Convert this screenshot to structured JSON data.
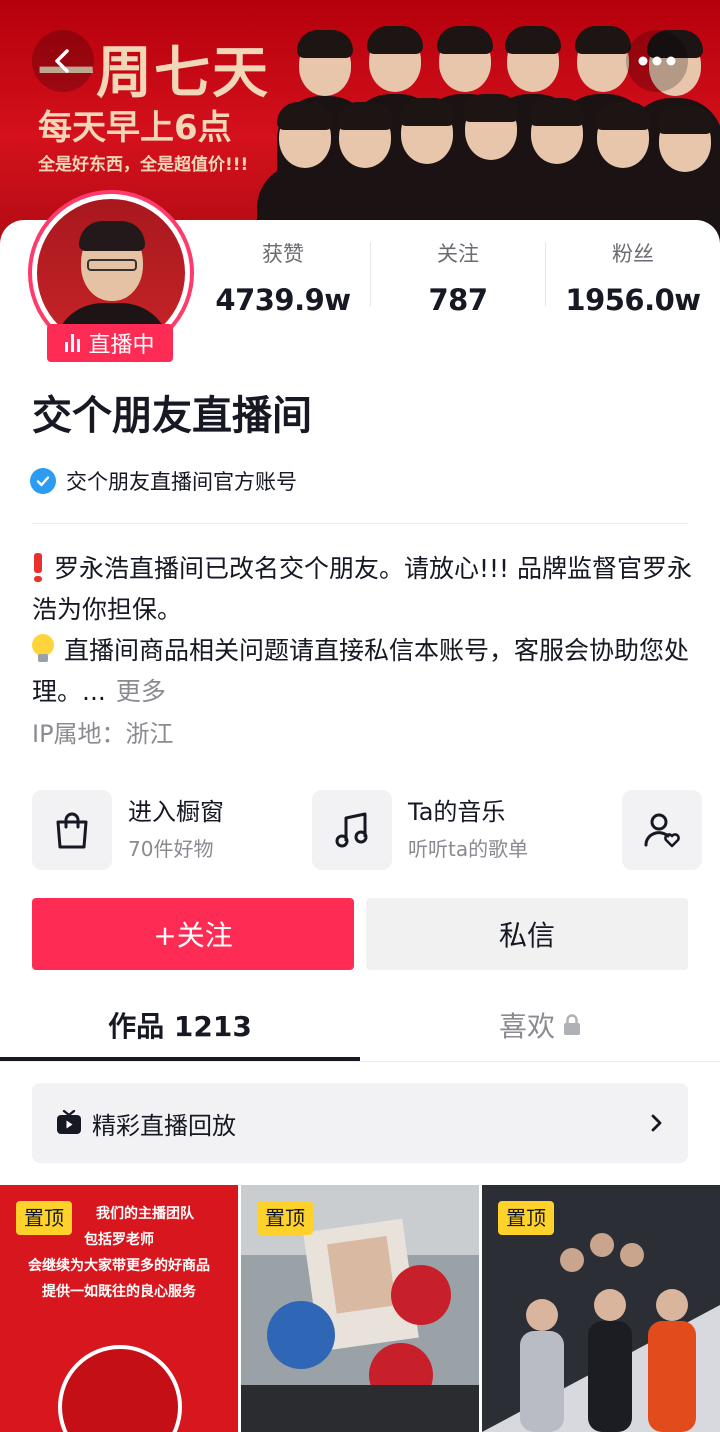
{
  "banner": {
    "line1": "一周七天",
    "line2": "每天早上6点",
    "line3": "全是好东西，全是超值价!!!"
  },
  "header": {
    "back_icon": "chevron-left-icon",
    "more_icon": "more-dots-icon"
  },
  "profile": {
    "live_label": "直播中",
    "name": "交个朋友直播间",
    "verified_text": "交个朋友直播间官方账号"
  },
  "stats": [
    {
      "label": "获赞",
      "value": "4739.9w"
    },
    {
      "label": "关注",
      "value": "787"
    },
    {
      "label": "粉丝",
      "value": "1956.0w"
    }
  ],
  "bio": {
    "line1": "罗永浩直播间已改名交个朋友。请放心!!! 品牌监督官罗永浩为你担保。",
    "line2": "直播间商品相关问题请直接私信本账号，客服会协助您处理。...",
    "more": "更多",
    "ip": "IP属地：浙江"
  },
  "features": [
    {
      "icon": "shopping-bag-icon",
      "title": "进入橱窗",
      "subtitle": "70件好物"
    },
    {
      "icon": "music-note-icon",
      "title": "Ta的音乐",
      "subtitle": "听听ta的歌单"
    },
    {
      "icon": "user-heart-icon",
      "title": "",
      "subtitle": ""
    }
  ],
  "actions": {
    "follow": "+关注",
    "message": "私信"
  },
  "tabs": {
    "works": "作品 1213",
    "likes": "喜欢"
  },
  "replay": {
    "label": "精彩直播回放"
  },
  "thumbnails": [
    {
      "pin": "置顶",
      "text1": "我们的主播团队",
      "text2": "包括罗老师",
      "text3": "会继续为大家带更多的好商品",
      "text4": "提供一如既往的良心服务"
    },
    {
      "pin": "置顶"
    },
    {
      "pin": "置顶"
    }
  ],
  "colors": {
    "accent": "#fe2c55",
    "pin": "#ffd12b",
    "verified": "#2b9cf2"
  }
}
